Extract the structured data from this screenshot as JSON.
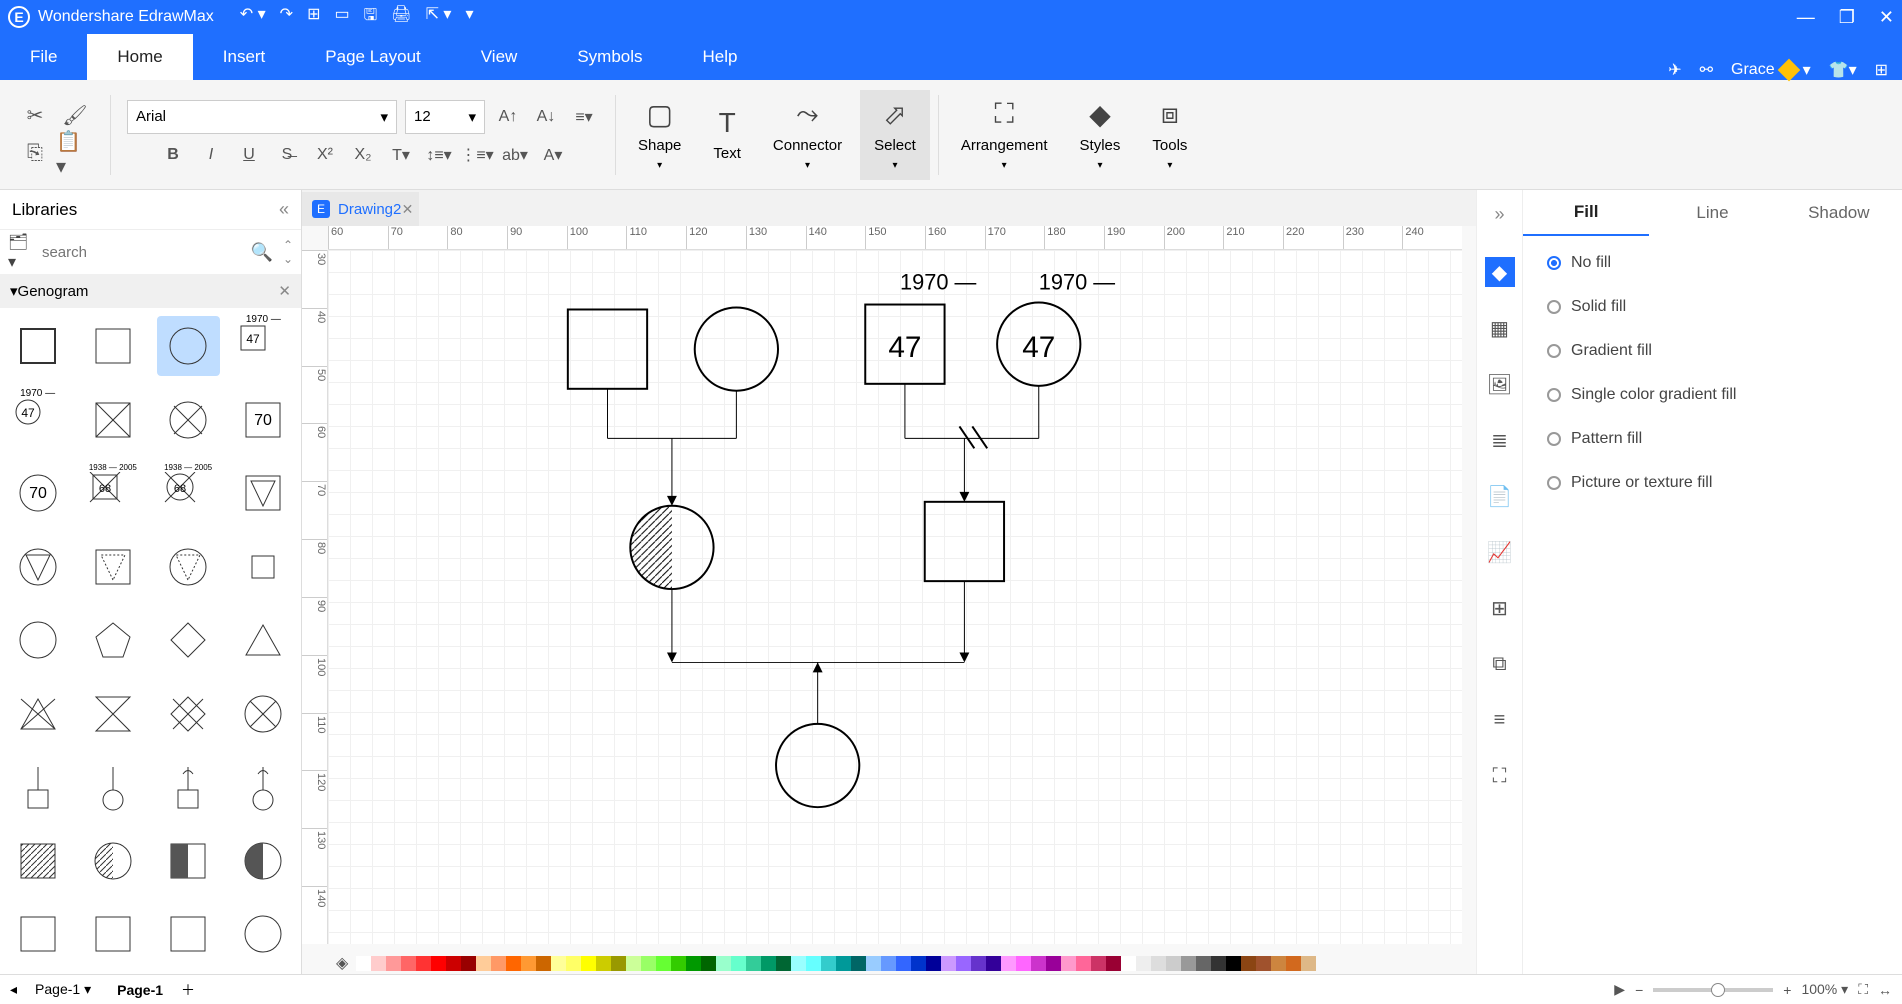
{
  "app": {
    "title": "Wondershare EdrawMax"
  },
  "user": {
    "name": "Grace"
  },
  "menus": {
    "file": "File",
    "home": "Home",
    "insert": "Insert",
    "page_layout": "Page Layout",
    "view": "View",
    "symbols": "Symbols",
    "help": "Help"
  },
  "ribbon": {
    "font_family": "Arial",
    "font_size": "12",
    "shape": "Shape",
    "text": "Text",
    "connector": "Connector",
    "select": "Select",
    "arrangement": "Arrangement",
    "styles": "Styles",
    "tools": "Tools"
  },
  "libraries": {
    "title": "Libraries",
    "search_placeholder": "search",
    "category": "Genogram"
  },
  "tabs": {
    "drawing": "Drawing2"
  },
  "ruler_h": [
    "60",
    "70",
    "80",
    "90",
    "100",
    "110",
    "120",
    "130",
    "140",
    "150",
    "160",
    "170",
    "180",
    "190",
    "200",
    "210",
    "220",
    "230",
    "240"
  ],
  "ruler_v": [
    "30",
    "40",
    "50",
    "60",
    "70",
    "80",
    "90",
    "100",
    "110",
    "120",
    "130",
    "140"
  ],
  "genogram": {
    "year_label": "1970",
    "age_label": "47",
    "shape_year": "1970",
    "shape_year_age_47": "47",
    "shape_70": "70",
    "shape_year_range": "1938 — 2005",
    "shape_68": "68"
  },
  "right_panel": {
    "tabs": {
      "fill": "Fill",
      "line": "Line",
      "shadow": "Shadow"
    },
    "options": {
      "no_fill": "No fill",
      "solid_fill": "Solid fill",
      "gradient_fill": "Gradient fill",
      "single_color": "Single color gradient fill",
      "pattern_fill": "Pattern fill",
      "picture_fill": "Picture or texture fill"
    }
  },
  "statusbar": {
    "page_dropdown": "Page-1",
    "page_tab": "Page-1",
    "zoom_level": "100%"
  },
  "palette_colors": [
    "#fff",
    "#FFCCCC",
    "#FF9999",
    "#FF6666",
    "#FF3333",
    "#FF0000",
    "#CC0000",
    "#990000",
    "#FFCC99",
    "#FF9966",
    "#FF6600",
    "#FF9933",
    "#CC6600",
    "#FFFF99",
    "#FFFF66",
    "#FFFF00",
    "#CCCC00",
    "#999900",
    "#CCFF99",
    "#99FF66",
    "#66FF33",
    "#33CC00",
    "#009900",
    "#006600",
    "#99FFCC",
    "#66FFCC",
    "#33CC99",
    "#009966",
    "#006633",
    "#99FFFF",
    "#66FFFF",
    "#33CCCC",
    "#009999",
    "#006666",
    "#99CCFF",
    "#6699FF",
    "#3366FF",
    "#0033CC",
    "#000099",
    "#CC99FF",
    "#9966FF",
    "#6633CC",
    "#330099",
    "#FF99FF",
    "#FF66FF",
    "#CC33CC",
    "#990099",
    "#FF99CC",
    "#FF6699",
    "#CC3366",
    "#990033",
    "#ffffff",
    "#EEEEEE",
    "#DDDDDD",
    "#CCCCCC",
    "#999999",
    "#666666",
    "#333333",
    "#000000",
    "#8B4513",
    "#A0522D",
    "#CD853F",
    "#D2691E",
    "#DEB887"
  ]
}
